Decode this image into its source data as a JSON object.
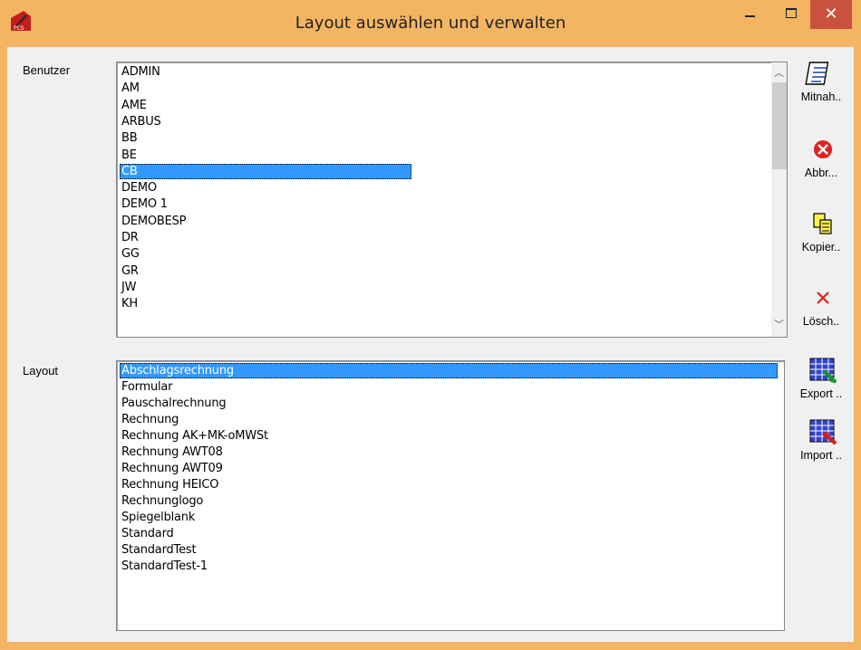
{
  "window": {
    "title": "Layout auswählen und verwalten",
    "app_icon": "pcs-logo-icon",
    "close_glyph": "✕"
  },
  "benutzer": {
    "label": "Benutzer",
    "items": [
      "ADMIN",
      "AM",
      "AME",
      "ARBUS",
      "BB",
      "BE",
      "CB",
      "DEMO",
      "DEMO 1",
      "DEMOBESP",
      "DR",
      "GG",
      "GR",
      "JW",
      "KH"
    ],
    "selected": "CB"
  },
  "layout": {
    "label": "Layout",
    "items": [
      "Abschlagsrechnung",
      "Formular",
      "Pauschalrechnung",
      "Rechnung",
      "Rechnung AK+MK-oMWSt",
      "Rechnung AWT08",
      "Rechnung AWT09",
      "Rechnung HEICO",
      "Rechnunglogo",
      "Spiegelblank",
      "Standard",
      "StandardTest",
      "StandardTest-1"
    ],
    "selected": "Abschlagsrechnung"
  },
  "buttons": {
    "mitnahme": {
      "label": "Mitnah..",
      "icon": "notepad-icon"
    },
    "abbruch": {
      "label": "Abbr...",
      "icon": "cancel-icon"
    },
    "kopieren": {
      "label": "Kopier..",
      "icon": "copy-icon"
    },
    "loeschen": {
      "label": "Lösch..",
      "icon": "delete-icon"
    },
    "export": {
      "label": "Export ..",
      "icon": "export-table-icon"
    },
    "import": {
      "label": "Import ..",
      "icon": "import-table-icon"
    }
  },
  "colors": {
    "titlebar": "#f4b563",
    "selection": "#3399ff",
    "close": "#c9513f"
  }
}
